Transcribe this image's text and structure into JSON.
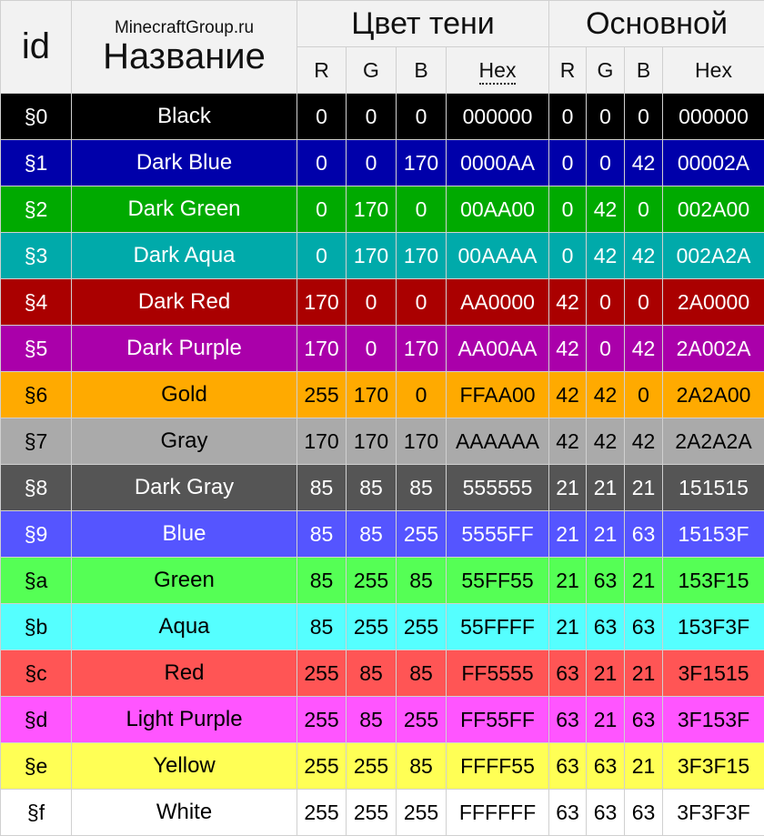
{
  "header": {
    "id_label": "id",
    "site_label": "MinecraftGroup.ru",
    "name_label": "Название",
    "shadow_group": "Цвет тени",
    "main_group": "Основной",
    "shadow_cols": [
      "R",
      "G",
      "B",
      "Hex"
    ],
    "main_cols": [
      "R",
      "G",
      "B",
      "Hex"
    ]
  },
  "rows": [
    {
      "id": "§0",
      "name": "Black",
      "s": [
        "0",
        "0",
        "0",
        "000000"
      ],
      "m": [
        "0",
        "0",
        "0",
        "000000"
      ],
      "bg": "#000000",
      "fg": "#ffffff"
    },
    {
      "id": "§1",
      "name": "Dark Blue",
      "s": [
        "0",
        "0",
        "170",
        "0000AA"
      ],
      "m": [
        "0",
        "0",
        "42",
        "00002A"
      ],
      "bg": "#0000AA",
      "fg": "#ffffff"
    },
    {
      "id": "§2",
      "name": "Dark Green",
      "s": [
        "0",
        "170",
        "0",
        "00AA00"
      ],
      "m": [
        "0",
        "42",
        "0",
        "002A00"
      ],
      "bg": "#00AA00",
      "fg": "#ffffff"
    },
    {
      "id": "§3",
      "name": "Dark Aqua",
      "s": [
        "0",
        "170",
        "170",
        "00AAAA"
      ],
      "m": [
        "0",
        "42",
        "42",
        "002A2A"
      ],
      "bg": "#00AAAA",
      "fg": "#ffffff"
    },
    {
      "id": "§4",
      "name": "Dark Red",
      "s": [
        "170",
        "0",
        "0",
        "AA0000"
      ],
      "m": [
        "42",
        "0",
        "0",
        "2A0000"
      ],
      "bg": "#AA0000",
      "fg": "#ffffff"
    },
    {
      "id": "§5",
      "name": "Dark Purple",
      "s": [
        "170",
        "0",
        "170",
        "AA00AA"
      ],
      "m": [
        "42",
        "0",
        "42",
        "2A002A"
      ],
      "bg": "#AA00AA",
      "fg": "#ffffff"
    },
    {
      "id": "§6",
      "name": "Gold",
      "s": [
        "255",
        "170",
        "0",
        "FFAA00"
      ],
      "m": [
        "42",
        "42",
        "0",
        "2A2A00"
      ],
      "bg": "#FFAA00",
      "fg": "#000000"
    },
    {
      "id": "§7",
      "name": "Gray",
      "s": [
        "170",
        "170",
        "170",
        "AAAAAA"
      ],
      "m": [
        "42",
        "42",
        "42",
        "2A2A2A"
      ],
      "bg": "#AAAAAA",
      "fg": "#000000"
    },
    {
      "id": "§8",
      "name": "Dark Gray",
      "s": [
        "85",
        "85",
        "85",
        "555555"
      ],
      "m": [
        "21",
        "21",
        "21",
        "151515"
      ],
      "bg": "#555555",
      "fg": "#ffffff"
    },
    {
      "id": "§9",
      "name": "Blue",
      "s": [
        "85",
        "85",
        "255",
        "5555FF"
      ],
      "m": [
        "21",
        "21",
        "63",
        "15153F"
      ],
      "bg": "#5555FF",
      "fg": "#ffffff"
    },
    {
      "id": "§a",
      "name": "Green",
      "s": [
        "85",
        "255",
        "85",
        "55FF55"
      ],
      "m": [
        "21",
        "63",
        "21",
        "153F15"
      ],
      "bg": "#55FF55",
      "fg": "#000000"
    },
    {
      "id": "§b",
      "name": "Aqua",
      "s": [
        "85",
        "255",
        "255",
        "55FFFF"
      ],
      "m": [
        "21",
        "63",
        "63",
        "153F3F"
      ],
      "bg": "#55FFFF",
      "fg": "#000000"
    },
    {
      "id": "§c",
      "name": "Red",
      "s": [
        "255",
        "85",
        "85",
        "FF5555"
      ],
      "m": [
        "63",
        "21",
        "21",
        "3F1515"
      ],
      "bg": "#FF5555",
      "fg": "#000000"
    },
    {
      "id": "§d",
      "name": "Light Purple",
      "s": [
        "255",
        "85",
        "255",
        "FF55FF"
      ],
      "m": [
        "63",
        "21",
        "63",
        "3F153F"
      ],
      "bg": "#FF55FF",
      "fg": "#000000"
    },
    {
      "id": "§e",
      "name": "Yellow",
      "s": [
        "255",
        "255",
        "85",
        "FFFF55"
      ],
      "m": [
        "63",
        "63",
        "21",
        "3F3F15"
      ],
      "bg": "#FFFF55",
      "fg": "#000000"
    },
    {
      "id": "§f",
      "name": "White",
      "s": [
        "255",
        "255",
        "255",
        "FFFFFF"
      ],
      "m": [
        "63",
        "63",
        "63",
        "3F3F3F"
      ],
      "bg": "#FFFFFF",
      "fg": "#000000"
    }
  ]
}
